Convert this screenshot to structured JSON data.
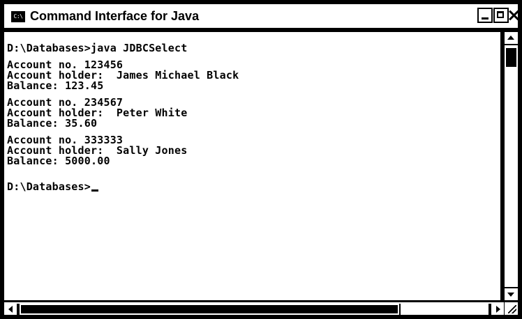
{
  "window": {
    "title": "Command Interface for Java",
    "icon_label": "C:\\",
    "icon": "console-icon",
    "buttons": [
      "minimize-icon",
      "maximize-icon",
      "close-icon"
    ]
  },
  "console": {
    "command_prompt": "D:\\Databases>java JDBCSelect",
    "records": [
      {
        "account_no": "Account no. 123456",
        "holder": "Account holder:  James Michael Black",
        "balance": "Balance: 123.45"
      },
      {
        "account_no": "Account no. 234567",
        "holder": "Account holder:  Peter White",
        "balance": "Balance: 35.60"
      },
      {
        "account_no": "Account no. 333333",
        "holder": "Account holder:  Sally Jones",
        "balance": "Balance: 5000.00"
      }
    ],
    "final_prompt": "D:\\Databases>"
  },
  "colors": {
    "frame": "#000000",
    "background": "#ffffff",
    "text": "#000000"
  }
}
